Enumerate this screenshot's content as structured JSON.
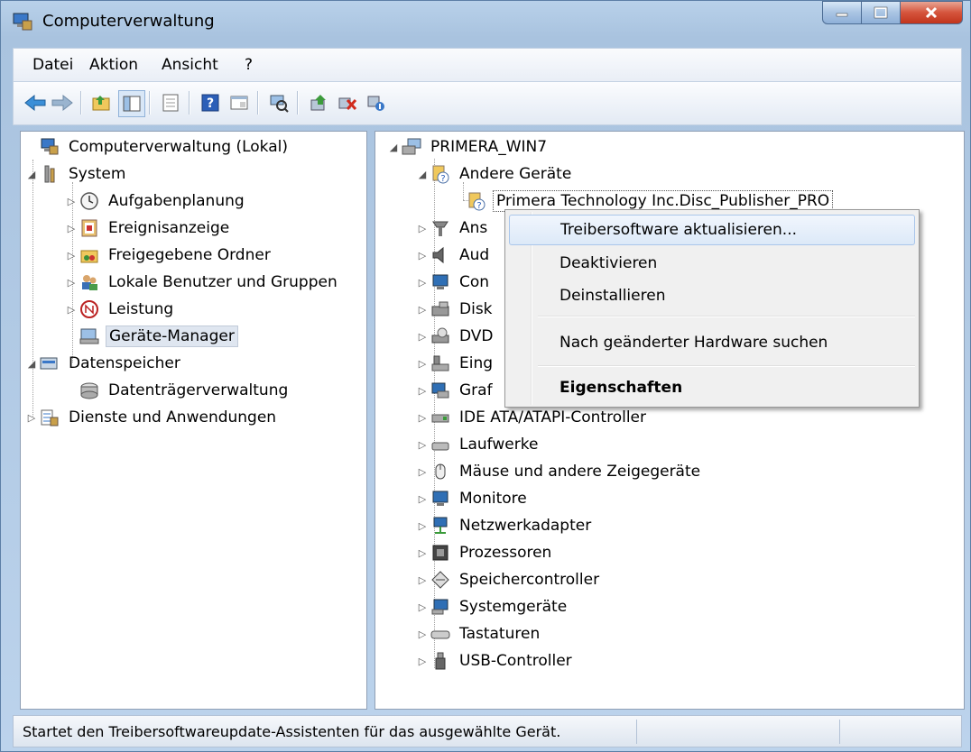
{
  "window": {
    "title": "Computerverwaltung"
  },
  "menu": [
    "Datei",
    "Aktion",
    "Ansicht",
    "?"
  ],
  "left_tree": [
    {
      "label": "Computerverwaltung (Lokal)",
      "level": 0,
      "expander": "",
      "icon": "computer-management-icon"
    },
    {
      "label": "System",
      "level": 1,
      "expander": "expanded",
      "icon": "system-tools-icon"
    },
    {
      "label": "Aufgabenplanung",
      "level": 2,
      "expander": "collapsed",
      "icon": "clock-icon"
    },
    {
      "label": "Ereignisanzeige",
      "level": 2,
      "expander": "collapsed",
      "icon": "event-viewer-icon"
    },
    {
      "label": "Freigegebene Ordner",
      "level": 2,
      "expander": "collapsed",
      "icon": "shared-folder-icon"
    },
    {
      "label": "Lokale Benutzer und Gruppen",
      "level": 2,
      "expander": "collapsed",
      "icon": "users-icon"
    },
    {
      "label": "Leistung",
      "level": 2,
      "expander": "collapsed",
      "icon": "performance-icon"
    },
    {
      "label": "Geräte-Manager",
      "level": 2,
      "expander": "",
      "icon": "device-manager-icon",
      "selected": true
    },
    {
      "label": "Datenspeicher",
      "level": 1,
      "expander": "expanded",
      "icon": "storage-icon"
    },
    {
      "label": "Datenträgerverwaltung",
      "level": 2,
      "expander": "",
      "icon": "disk-management-icon"
    },
    {
      "label": "Dienste und Anwendungen",
      "level": 1,
      "expander": "collapsed",
      "icon": "services-icon"
    }
  ],
  "right_tree": [
    {
      "label": "PRIMERA_WIN7",
      "level": 0,
      "expander": "expanded",
      "icon": "computer-icon"
    },
    {
      "label": "Andere Geräte",
      "level": 1,
      "expander": "expanded",
      "icon": "unknown-device-icon"
    },
    {
      "label": "Primera Technology Inc.Disc_Publisher_PRO",
      "level": 2,
      "expander": "",
      "icon": "unknown-device-icon",
      "focused": true
    },
    {
      "label": "Ans",
      "level": 1,
      "expander": "collapsed",
      "icon": "display-adapter-icon"
    },
    {
      "label": "Aud",
      "level": 1,
      "expander": "collapsed",
      "icon": "speaker-icon"
    },
    {
      "label": "Con",
      "level": 1,
      "expander": "collapsed",
      "icon": "monitor-icon"
    },
    {
      "label": "Disk",
      "level": 1,
      "expander": "collapsed",
      "icon": "disk-drive-icon"
    },
    {
      "label": "DVD",
      "level": 1,
      "expander": "collapsed",
      "icon": "dvd-drive-icon"
    },
    {
      "label": "Eing",
      "level": 1,
      "expander": "collapsed",
      "icon": "input-device-icon"
    },
    {
      "label": "Graf",
      "level": 1,
      "expander": "collapsed",
      "icon": "graphics-icon"
    },
    {
      "label": "IDE ATA/ATAPI-Controller",
      "level": 1,
      "expander": "collapsed",
      "icon": "ide-controller-icon"
    },
    {
      "label": "Laufwerke",
      "level": 1,
      "expander": "collapsed",
      "icon": "drive-icon"
    },
    {
      "label": "Mäuse und andere Zeigegeräte",
      "level": 1,
      "expander": "collapsed",
      "icon": "mouse-icon"
    },
    {
      "label": "Monitore",
      "level": 1,
      "expander": "collapsed",
      "icon": "monitor-icon"
    },
    {
      "label": "Netzwerkadapter",
      "level": 1,
      "expander": "collapsed",
      "icon": "network-adapter-icon"
    },
    {
      "label": "Prozessoren",
      "level": 1,
      "expander": "collapsed",
      "icon": "processor-icon"
    },
    {
      "label": "Speichercontroller",
      "level": 1,
      "expander": "collapsed",
      "icon": "storage-controller-icon"
    },
    {
      "label": "Systemgeräte",
      "level": 1,
      "expander": "collapsed",
      "icon": "system-devices-icon"
    },
    {
      "label": "Tastaturen",
      "level": 1,
      "expander": "collapsed",
      "icon": "keyboard-icon"
    },
    {
      "label": "USB-Controller",
      "level": 1,
      "expander": "collapsed",
      "icon": "usb-icon"
    }
  ],
  "context_menu": [
    {
      "label": "Treibersoftware aktualisieren...",
      "highlighted": true
    },
    {
      "label": "Deaktivieren"
    },
    {
      "label": "Deinstallieren"
    },
    {
      "separator": true
    },
    {
      "label": "Nach geänderter Hardware suchen"
    },
    {
      "separator": true
    },
    {
      "label": "Eigenschaften",
      "bold": true
    }
  ],
  "status": {
    "text": "Startet den Treibersoftwareupdate-Assistenten für das ausgewählte Gerät."
  },
  "colors": {
    "accent": "#2f6fb5",
    "selection_bg": "#dfe6f0",
    "menu_highlight": "#dce9f8"
  }
}
